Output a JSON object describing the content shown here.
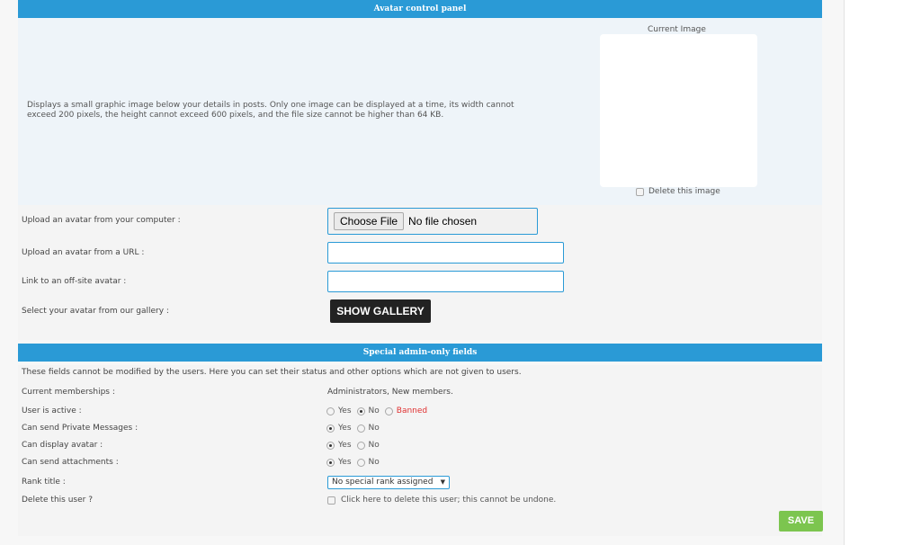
{
  "avatar_panel": {
    "title": "Avatar control panel",
    "description": "Displays a small graphic image below your details in posts. Only one image can be displayed at a time, its width cannot exceed 200 pixels, the height cannot exceed 600 pixels, and the file size cannot be higher than 64 KB.",
    "current_image_label": "Current Image",
    "delete_image_label": "Delete this image"
  },
  "upload": {
    "computer_label": "Upload an avatar from your computer :",
    "choose_file_label": "Choose File",
    "no_file_text": "No file chosen",
    "url_label": "Upload an avatar from a URL :",
    "url_value": "",
    "offsite_label": "Link to an off-site avatar :",
    "offsite_value": "",
    "gallery_label": "Select your avatar from our gallery :",
    "gallery_button": "SHOW GALLERY"
  },
  "admin": {
    "title": "Special admin-only fields",
    "note": "These fields cannot be modified by the users. Here you can set their status and other options which are not given to users.",
    "memberships_label": "Current memberships :",
    "memberships_value": "Administrators, New members.",
    "user_active": {
      "label": "User is active :",
      "options": [
        "Yes",
        "No",
        "Banned"
      ],
      "selected": "No"
    },
    "send_pm": {
      "label": "Can send Private Messages :",
      "options": [
        "Yes",
        "No"
      ],
      "selected": "Yes"
    },
    "display_avatar": {
      "label": "Can display avatar :",
      "options": [
        "Yes",
        "No"
      ],
      "selected": "Yes"
    },
    "send_attachments": {
      "label": "Can send attachments :",
      "options": [
        "Yes",
        "No"
      ],
      "selected": "Yes"
    },
    "rank_label": "Rank title :",
    "rank_value": "No special rank assigned",
    "delete_user_label": "Delete this user ?",
    "delete_user_text": "Click here to delete this user; this cannot be undone.",
    "save_button": "SAVE"
  },
  "colors": {
    "header_blue": "#2a9ad6",
    "save_green": "#7cc54f",
    "banned_red": "#e03030"
  }
}
